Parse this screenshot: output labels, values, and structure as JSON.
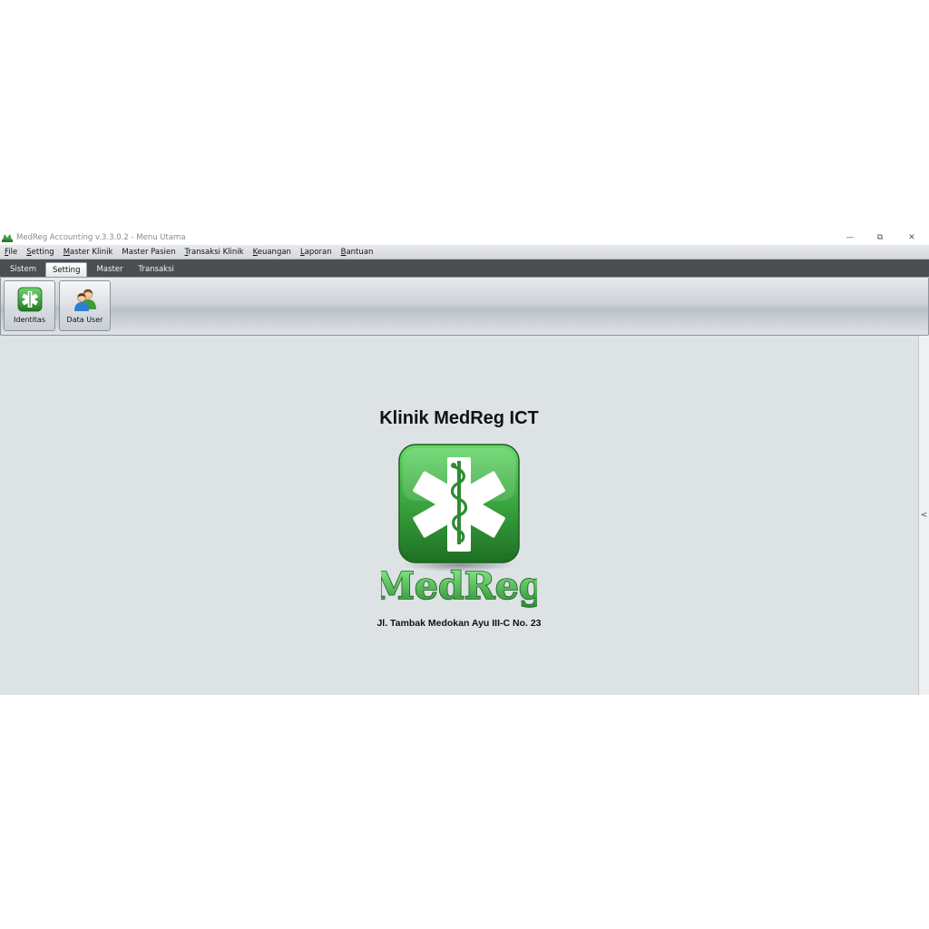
{
  "window": {
    "title": "MedReg Accounting v.3.3.0.2 - Menu Utama",
    "minimize": "—",
    "restore": "⧉",
    "close": "✕"
  },
  "menu": [
    {
      "accel": "F",
      "rest": "ile"
    },
    {
      "accel": "S",
      "rest": "etting"
    },
    {
      "accel": "M",
      "rest": "aster Klinik"
    },
    {
      "accel": "",
      "rest": "Master Pasien"
    },
    {
      "accel": "T",
      "rest": "ransaksi Klinik"
    },
    {
      "accel": "K",
      "rest": "euangan"
    },
    {
      "accel": "L",
      "rest": "aporan"
    },
    {
      "accel": "B",
      "rest": "antuan"
    }
  ],
  "tabs": [
    "Sistem",
    "Setting",
    "Master",
    "Transaksi"
  ],
  "active_tab": "Setting",
  "ribbon": {
    "identitas_label": "Identitas",
    "data_user_label": "Data User"
  },
  "main": {
    "clinic_name": "Klinik MedReg ICT",
    "logo_text": "MedReg",
    "address": "Jl. Tambak Medokan Ayu III-C No. 23"
  },
  "side_panel": {
    "toggle": "<"
  },
  "colors": {
    "accent_green": "#3a9a3e",
    "tab_strip": "#4b4f54",
    "content_bg": "#dde2e5"
  },
  "icons": {
    "app": "medreg-app-icon",
    "identitas": "star-of-life-icon",
    "data_user": "users-icon"
  }
}
